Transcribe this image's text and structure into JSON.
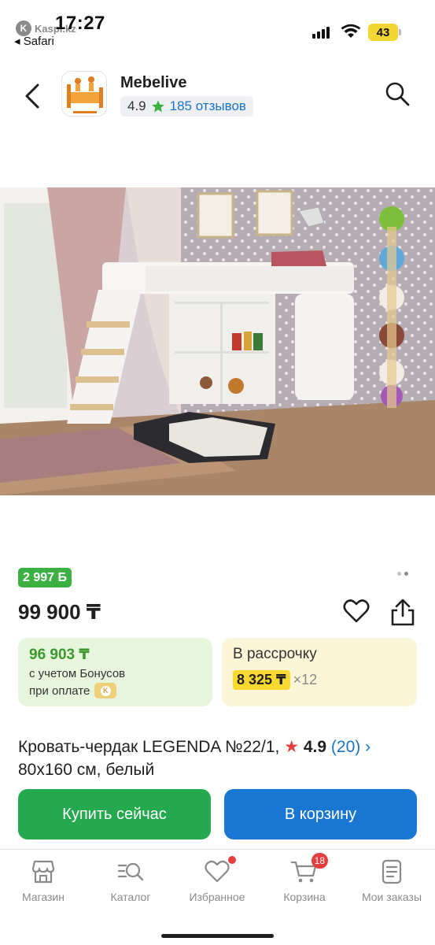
{
  "status_bar": {
    "time": "17:27",
    "back_app": "◂ Safari",
    "kaspi_label": "Kaspi.kz",
    "battery": "43"
  },
  "header": {
    "shop_name": "Mebelive",
    "shop_rating": "4.9",
    "shop_reviews": "185 отзывов"
  },
  "price_block": {
    "bonus_badge": "2 997 Б",
    "price": "99 900 ₸",
    "bonus_card": {
      "price": "96 903 ₸",
      "line1": "с учетом Бонусов",
      "line2": "при оплате"
    },
    "installment_card": {
      "title": "В рассрочку",
      "amount": "8 325 ₸",
      "months": "×12"
    }
  },
  "product": {
    "title_line1": "Кровать-чердак LEGENDA №22/1,",
    "title_line2": "80x160 см, белый",
    "rating": "4.9",
    "reviews": "(20)",
    "image_pages": 2,
    "image_active_page": 2
  },
  "actions": {
    "buy_now": "Купить сейчас",
    "add_to_cart": "В корзину"
  },
  "tabbar": {
    "items": [
      {
        "label": "Магазин",
        "icon": "shop-icon"
      },
      {
        "label": "Каталог",
        "icon": "catalog-search-icon"
      },
      {
        "label": "Избранное",
        "icon": "heart-icon"
      },
      {
        "label": "Корзина",
        "icon": "cart-icon",
        "badge": "18"
      },
      {
        "label": "Мои заказы",
        "icon": "orders-icon"
      }
    ]
  },
  "colors": {
    "green": "#25a94f",
    "blue": "#1976d2",
    "bonus_green": "#3cb043",
    "installment_yellow": "#f7d932",
    "badge_red": "#e53e3e"
  }
}
